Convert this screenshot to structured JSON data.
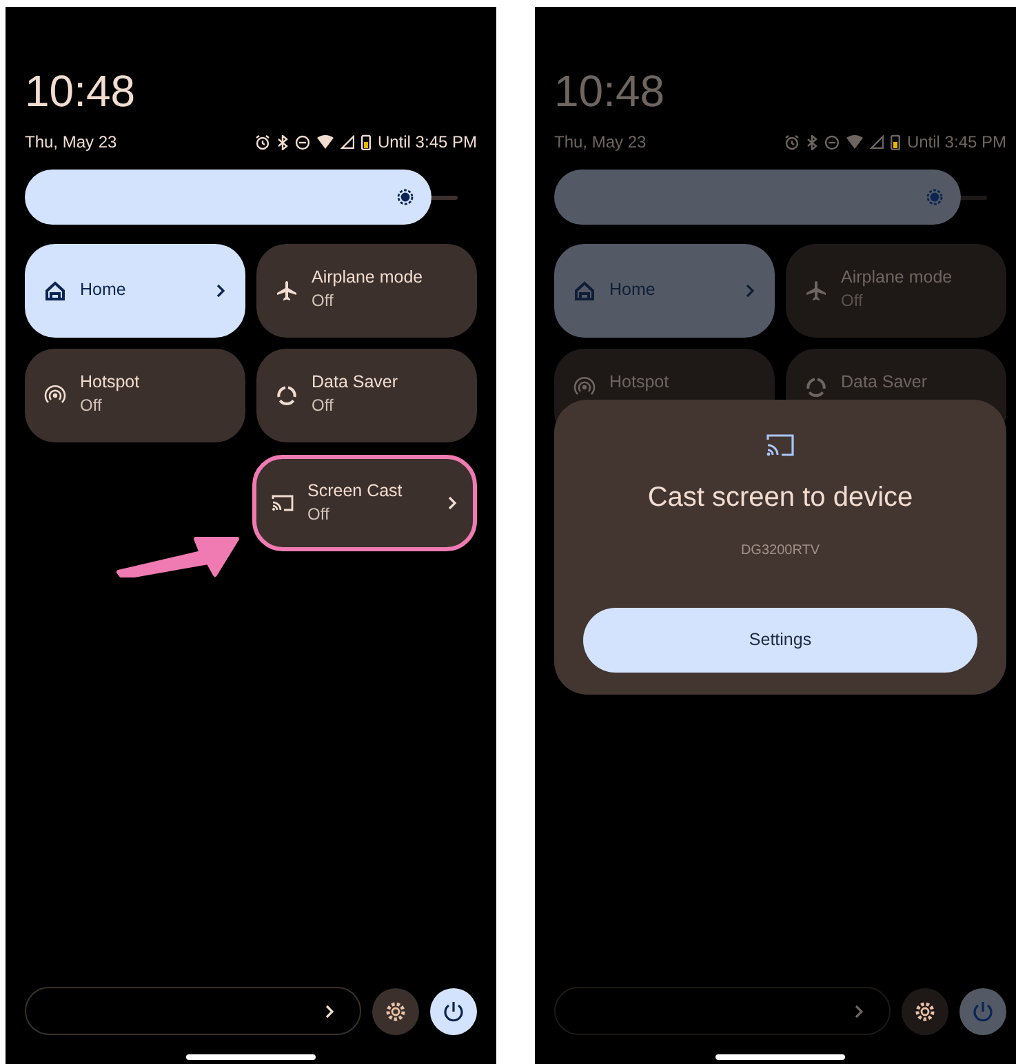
{
  "screens": [
    {
      "dimmed": false,
      "clock": "10:48",
      "date": "Thu, May 23",
      "status_text": "Until 3:45 PM",
      "tile_rows": [
        [
          {
            "label": "Home",
            "on": true,
            "expandable": true,
            "highlighted": false
          },
          {
            "label": "Airplane mode",
            "sub": "Off",
            "on": false,
            "expandable": false,
            "highlighted": false
          }
        ],
        [
          {
            "label": "Hotspot",
            "sub": "Off",
            "on": false,
            "expandable": false,
            "highlighted": false
          },
          {
            "label": "Data Saver",
            "sub": "Off",
            "on": false,
            "expandable": false,
            "highlighted": false
          }
        ],
        [
          {
            "label": "Screen Cast",
            "sub": "Off",
            "on": false,
            "expandable": true,
            "highlighted": true
          }
        ]
      ],
      "pointer_arrow": true
    },
    {
      "dimmed": true,
      "clock": "10:48",
      "date": "Thu, May 23",
      "status_text": "Until 3:45 PM",
      "tile_rows": [
        [
          {
            "label": "Home",
            "on": true,
            "expandable": true,
            "highlighted": false
          },
          {
            "label": "Airplane mode",
            "sub": "Off",
            "on": false,
            "expandable": false,
            "highlighted": false
          }
        ],
        [
          {
            "label": "Hotspot",
            "on": false,
            "highlighted": false
          },
          {
            "label": "Data Saver",
            "on": false,
            "highlighted": false
          }
        ]
      ],
      "pointer_arrow": false,
      "dialog": {
        "title": "Cast screen to device",
        "device": "DG3200RTV",
        "button": "Settings"
      }
    }
  ]
}
